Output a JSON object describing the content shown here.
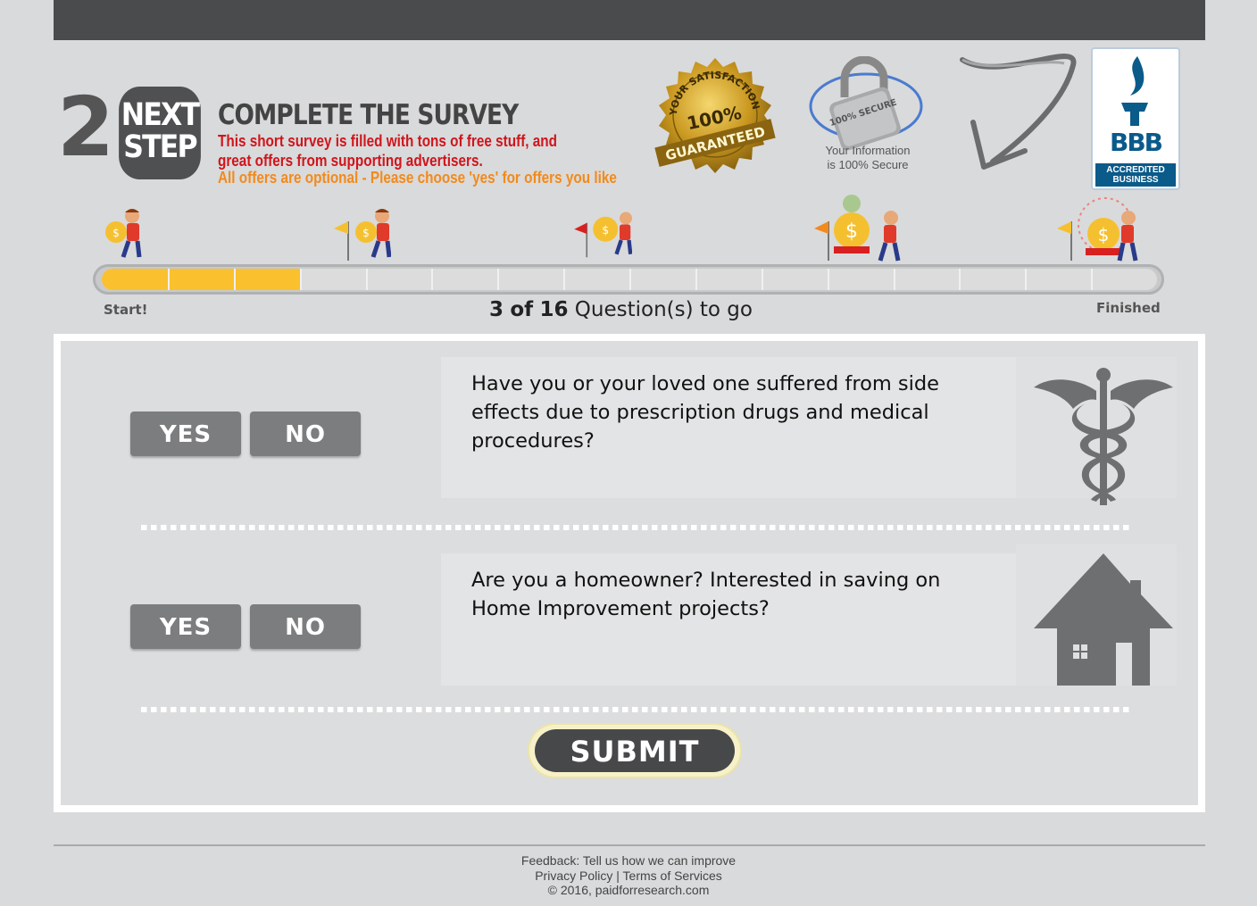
{
  "header": {
    "step_number": "2",
    "step_label_line1": "NEXT",
    "step_label_line2": "STEP",
    "title": "COMPLETE THE SURVEY",
    "description": "This short survey is filled with tons of free stuff, and great offers from supporting advertisers.",
    "note": "All offers are optional - Please choose 'yes' for offers you like",
    "seal_text_top": "YOUR SATISFACTION",
    "seal_percent": "100%",
    "seal_text_bottom": "GUARANTEED",
    "lock_text": "100% SECURE",
    "secure_line1": "Your Information",
    "secure_line2": "is 100% Secure",
    "bbb_letters": "BBB",
    "bbb_band_line1": "ACCREDITED",
    "bbb_band_line2": "BUSINESS"
  },
  "progress": {
    "start_label": "Start!",
    "finish_label": "Finished",
    "current": "3",
    "of_word": "of",
    "total": "16",
    "suffix": "Question(s) to go",
    "filled_fraction": 0.1875,
    "segments": 16
  },
  "questions": [
    {
      "yes_label": "YES",
      "no_label": "NO",
      "text": "Have you or your loved one suffered from side effects due to prescription drugs and medical procedures?",
      "icon": "caduceus-icon"
    },
    {
      "yes_label": "YES",
      "no_label": "NO",
      "text": "Are you a homeowner? Interested in saving on Home Improvement projects?",
      "icon": "house-icon"
    }
  ],
  "submit_label": "SUBMIT",
  "footer": {
    "feedback": "Feedback: Tell us how we can improve",
    "privacy": "Privacy Policy",
    "separator": "|",
    "terms": "Terms of Services",
    "copyright": "© 2016, paidforresearch.com"
  },
  "colors": {
    "progress_fill": "#fbc02d",
    "title_red": "#d0151c",
    "note_orange": "#f28a1c",
    "button_grey": "#7c7d7e",
    "bbb_blue": "#0a5a8a"
  }
}
